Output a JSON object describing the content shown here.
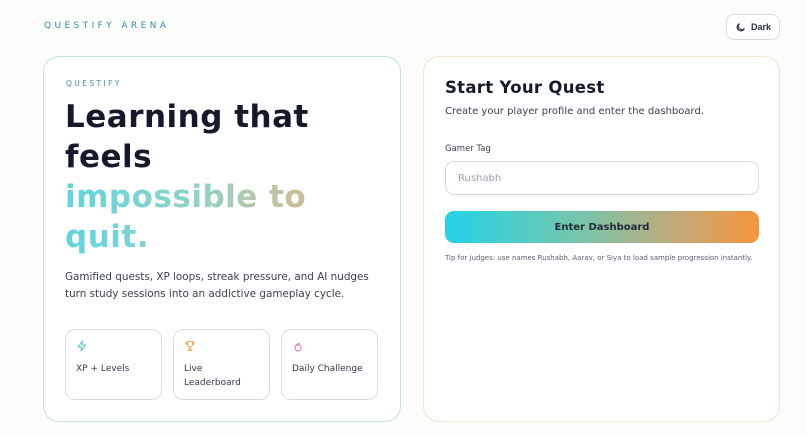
{
  "header": {
    "brand": "QUESTIFY ARENA",
    "theme_toggle_label": "Dark",
    "theme_toggle_icon": "moon-icon"
  },
  "hero_card": {
    "eyebrow": "QUESTIFY",
    "headline_line1": "Learning that",
    "headline_line2": "feels",
    "headline_accent_line1": "impossible to",
    "headline_accent_line2": "quit.",
    "description": "Gamified quests, XP loops, streak pressure, and AI nudges turn study sessions into an addictive gameplay cycle.",
    "features": [
      {
        "label": "XP + Levels",
        "icon": "lightning-icon",
        "color": "#4fc3d9"
      },
      {
        "label": "Live Leaderboard",
        "icon": "trophy-icon",
        "color": "#f5a04a"
      },
      {
        "label": "Daily Challenge",
        "icon": "flame-icon",
        "color": "#e67bb0"
      }
    ]
  },
  "login_card": {
    "title": "Start Your Quest",
    "subtitle": "Create your player profile and enter the dashboard.",
    "gamer_tag_label": "Gamer Tag",
    "gamer_tag_placeholder": "Rushabh",
    "gamer_tag_value": "",
    "submit_label": "Enter Dashboard",
    "tip": "Tip for judges: use names Rushabh, Aarav, or Siya to load sample progression instantly."
  },
  "colors": {
    "accent_teal": "#22d3e7",
    "accent_orange": "#f5953c",
    "brand_text": "#2f8fa3"
  }
}
